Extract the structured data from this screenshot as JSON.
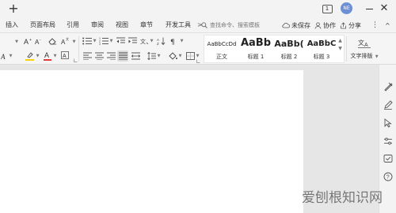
{
  "titlebar": {
    "new_tab_label": "+",
    "badge_label": "1",
    "avatar_label": "NE",
    "close_label": "✕"
  },
  "menu": {
    "items": [
      "插入",
      "页面布局",
      "引用",
      "审阅",
      "视图",
      "章节",
      "开发工具"
    ],
    "more_label": ">",
    "search_placeholder": "查找命令、搜索模板",
    "unsaved_label": "未保存",
    "collab_label": "协作",
    "share_label": "分享",
    "more_icon": "⋮",
    "collapse_icon": "^"
  },
  "ribbon": {
    "styles": [
      {
        "sample": "AaBbCcDd",
        "name": "正文"
      },
      {
        "sample": "AaBb",
        "name": "标题 1"
      },
      {
        "sample": "AaBb(",
        "name": "标题 2"
      },
      {
        "sample": "AaBbC",
        "name": "标题 3"
      }
    ],
    "text_layout_label": "文字排版",
    "text_layout_icon": "文A"
  },
  "watermark": {
    "text": "爱刨根知识网"
  },
  "colors": {
    "highlight_yellow": "#f5d10f",
    "font_red": "#e23b3b",
    "accent_blue": "#3b7cea"
  }
}
